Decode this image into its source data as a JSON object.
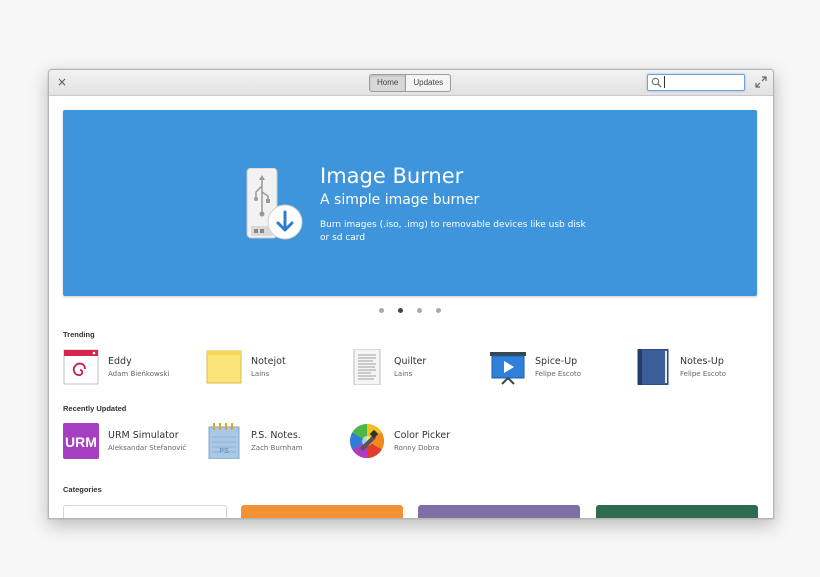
{
  "window": {
    "close_glyph": "×",
    "tabs": [
      {
        "label": "Home",
        "active": true
      },
      {
        "label": "Updates",
        "active": false
      }
    ],
    "search": {
      "value": "",
      "placeholder": ""
    }
  },
  "banner": {
    "title": "Image Burner",
    "subtitle": "A simple image burner",
    "description": "Burn images (.iso, .img) to removable devices like usb disk or sd card",
    "color": "#3e95dc",
    "icon": "usb-drive-download-icon",
    "carousel_count": 4,
    "carousel_active": 1
  },
  "trending": {
    "title": "Trending",
    "apps": [
      {
        "name": "Eddy",
        "author": "Adam Bieńkowski",
        "icon": "debian-package-icon"
      },
      {
        "name": "Notejot",
        "author": "Lains",
        "icon": "sticky-note-icon"
      },
      {
        "name": "Quilter",
        "author": "Lains",
        "icon": "text-document-icon"
      },
      {
        "name": "Spice-Up",
        "author": "Felipe Escoto",
        "icon": "presentation-screen-icon"
      },
      {
        "name": "Notes-Up",
        "author": "Felipe Escoto",
        "icon": "notebook-icon"
      }
    ]
  },
  "recently_updated": {
    "title": "Recently Updated",
    "apps": [
      {
        "name": "URM Simulator",
        "author": "Aleksandar Stefanović",
        "icon": "urm-icon",
        "icon_text": "URM"
      },
      {
        "name": "P.S. Notes.",
        "author": "Zach Burnham",
        "icon": "notepad-icon"
      },
      {
        "name": "Color Picker",
        "author": "Ronny Dobra",
        "icon": "color-wheel-icon"
      }
    ]
  },
  "categories": {
    "title": "Categories",
    "colors": [
      "#ffffff",
      "#f39235",
      "#7e6fa6",
      "#2f6b4f"
    ]
  }
}
